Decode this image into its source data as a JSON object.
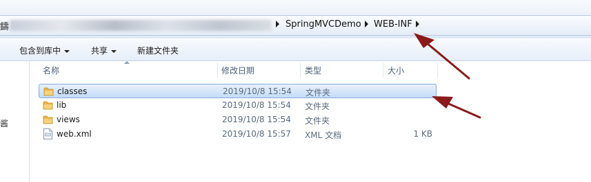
{
  "address_bar": {
    "crumbs": [
      "SpringMVCDemo",
      "WEB-INF"
    ]
  },
  "toolbar": {
    "include_in_library": "包含到库中",
    "share": "共享",
    "new_folder": "新建文件夹"
  },
  "columns": {
    "name": "名称",
    "modified": "修改日期",
    "type": "类型",
    "size": "大小"
  },
  "files": [
    {
      "name": "classes",
      "modified": "2019/10/8 15:54",
      "type": "文件夹",
      "size": "",
      "icon": "folder-icon",
      "selected": true
    },
    {
      "name": "lib",
      "modified": "2019/10/8 15:54",
      "type": "文件夹",
      "size": "",
      "icon": "folder-icon",
      "selected": false
    },
    {
      "name": "views",
      "modified": "2019/10/8 15:54",
      "type": "文件夹",
      "size": "",
      "icon": "folder-icon",
      "selected": false
    },
    {
      "name": "web.xml",
      "modified": "2019/10/8 15:57",
      "type": "XML 文档",
      "size": "1 KB",
      "icon": "xml-file-icon",
      "selected": false
    }
  ],
  "colors": {
    "selection": "#c4dcf7",
    "annotation_arrow": "#8b1a1a"
  }
}
